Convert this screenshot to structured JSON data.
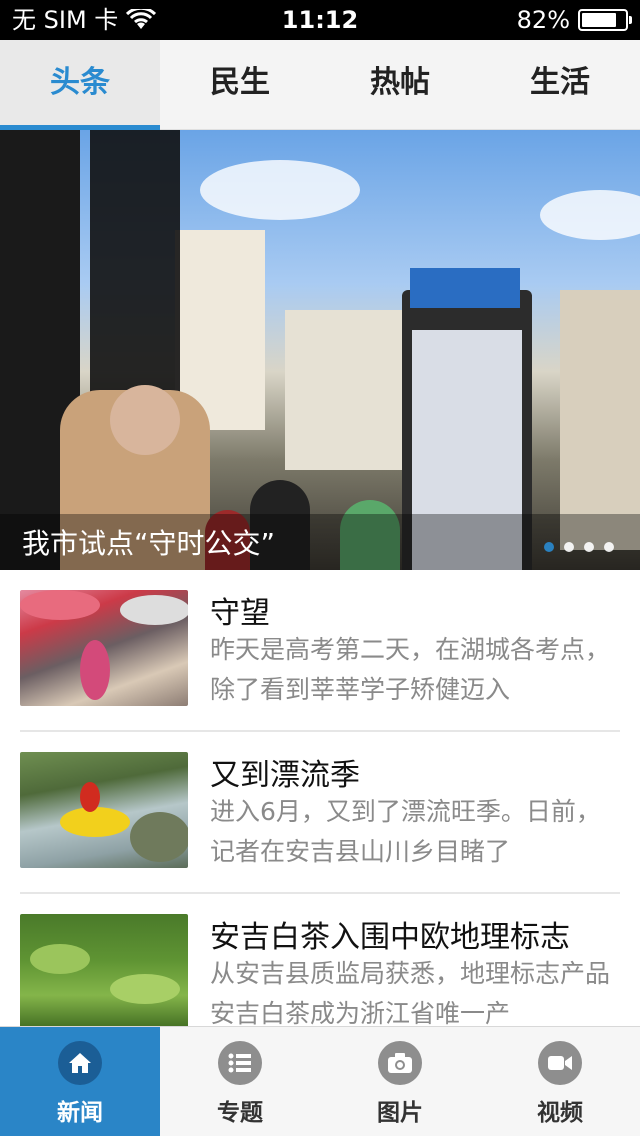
{
  "status_bar": {
    "carrier": "无 SIM 卡",
    "time": "11:12",
    "battery_percent": "82%",
    "battery_level": 0.82
  },
  "tabs": [
    {
      "label": "头条",
      "active": true
    },
    {
      "label": "民生",
      "active": false
    },
    {
      "label": "热帖",
      "active": false
    },
    {
      "label": "生活",
      "active": false
    }
  ],
  "banner": {
    "caption": "我市试点“守时公交”",
    "page_count": 4,
    "active_page": 1
  },
  "news": [
    {
      "title": "守望",
      "desc": "昨天是高考第二天，在湖城各考点，除了看到莘莘学子矫健迈入"
    },
    {
      "title": "又到漂流季",
      "desc": "进入6月，又到了漂流旺季。日前，记者在安吉县山川乡目睹了"
    },
    {
      "title": "安吉白茶入围中欧地理标志",
      "desc": "从安吉县质监局获悉，地理标志产品安吉白茶成为浙江省唯一产"
    }
  ],
  "bottom_nav": [
    {
      "label": "新闻",
      "icon": "home-icon",
      "active": true
    },
    {
      "label": "专题",
      "icon": "list-icon",
      "active": false
    },
    {
      "label": "图片",
      "icon": "camera-icon",
      "active": false
    },
    {
      "label": "视频",
      "icon": "video-icon",
      "active": false
    }
  ],
  "colors": {
    "accent": "#2a8bd0",
    "nav_active": "#2a85c7"
  }
}
